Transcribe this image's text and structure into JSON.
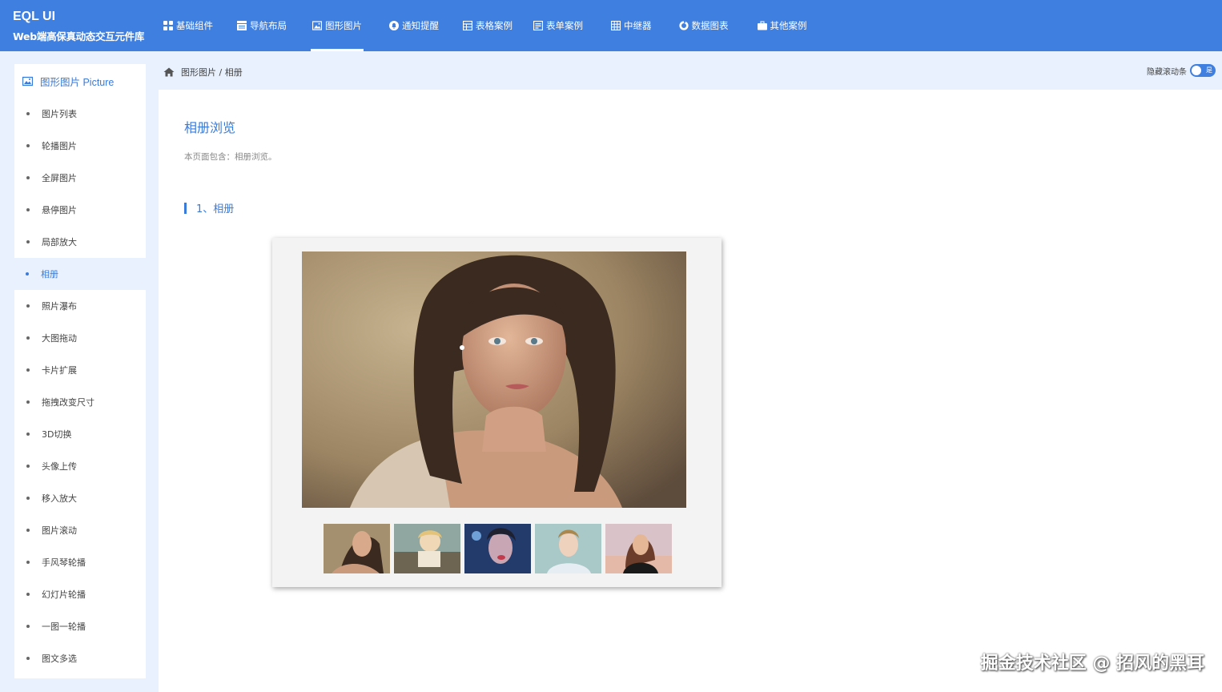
{
  "brand": {
    "name": "EQL UI",
    "subtitle": "Web端高保真动态交互元件库"
  },
  "nav": [
    {
      "label": "基础组件",
      "icon": "grid-icon"
    },
    {
      "label": "导航布局",
      "icon": "layout-icon"
    },
    {
      "label": "图形图片",
      "icon": "image-icon",
      "active": true
    },
    {
      "label": "通知提醒",
      "icon": "bell-icon"
    },
    {
      "label": "表格案例",
      "icon": "table-icon"
    },
    {
      "label": "表单案例",
      "icon": "form-icon"
    },
    {
      "label": "中继器",
      "icon": "repeater-icon"
    },
    {
      "label": "数据图表",
      "icon": "chart-icon"
    },
    {
      "label": "其他案例",
      "icon": "briefcase-icon"
    }
  ],
  "sidebar": {
    "title": "图形图片 Picture",
    "items": [
      {
        "label": "图片列表"
      },
      {
        "label": "轮播图片"
      },
      {
        "label": "全屏图片"
      },
      {
        "label": "悬停图片"
      },
      {
        "label": "局部放大"
      },
      {
        "label": "相册",
        "active": true
      },
      {
        "label": "照片瀑布"
      },
      {
        "label": "大图拖动"
      },
      {
        "label": "卡片扩展"
      },
      {
        "label": "拖拽改变尺寸"
      },
      {
        "label": "3D切换"
      },
      {
        "label": "头像上传"
      },
      {
        "label": "移入放大"
      },
      {
        "label": "图片滚动"
      },
      {
        "label": "手风琴轮播"
      },
      {
        "label": "幻灯片轮播"
      },
      {
        "label": "一图一轮播"
      },
      {
        "label": "图文多选"
      }
    ]
  },
  "breadcrumb": {
    "text": "图形图片 / 相册"
  },
  "toggle": {
    "label": "隐藏滚动条",
    "state": "是"
  },
  "content": {
    "title": "相册浏览",
    "description": "本页面包含：相册浏览。",
    "section": "1、相册"
  },
  "watermark": "掘金技术社区 @ 招风的黑耳",
  "colors": {
    "primary": "#3f7fe0",
    "accent": "#3a7ad8",
    "page_bg": "#e8f1fd"
  }
}
